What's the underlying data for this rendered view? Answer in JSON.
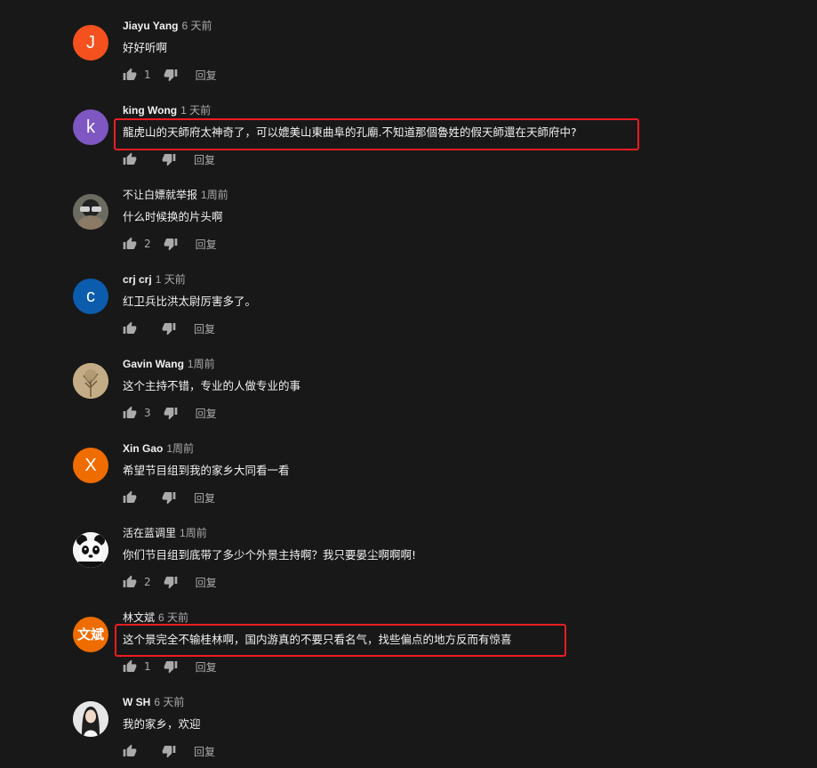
{
  "reply_label": "回复",
  "comments": [
    {
      "author": "Jiayu Yang",
      "time": "6 天前",
      "text": "好好听啊",
      "likes": "1",
      "avatar_letter": "J",
      "avatar_color": "#f4511e",
      "highlighted": false
    },
    {
      "author": "king Wong",
      "time": "1 天前",
      "text": "龍虎山的天師府太神奇了，可以媲美山東曲阜的孔廟.不知道那個魯姓的假天師還在天師府中?",
      "likes": "",
      "avatar_letter": "k",
      "avatar_color": "#7e57c2",
      "highlighted": true
    },
    {
      "author": "不让白嫖就举报",
      "time": "1周前",
      "text": "什么时候换的片头啊",
      "likes": "2",
      "avatar_letter": "",
      "avatar_color": "#5a4a3a",
      "highlighted": false
    },
    {
      "author": "crj crj",
      "time": "1 天前",
      "text": "红卫兵比洪太尉厉害多了。",
      "likes": "",
      "avatar_letter": "c",
      "avatar_color": "#0b5cad",
      "highlighted": false
    },
    {
      "author": "Gavin Wang",
      "time": "1周前",
      "text": "这个主持不错，专业的人做专业的事",
      "likes": "3",
      "avatar_letter": "",
      "avatar_color": "#b9a07a",
      "highlighted": false
    },
    {
      "author": "Xin Gao",
      "time": "1周前",
      "text": "希望节目组到我的家乡大同看一看",
      "likes": "",
      "avatar_letter": "X",
      "avatar_color": "#ef6c00",
      "highlighted": false
    },
    {
      "author": "活在蓝调里",
      "time": "1周前",
      "text": "你们节目组到底带了多少个外景主持啊？我只要晏尘啊啊啊!",
      "likes": "2",
      "avatar_letter": "",
      "avatar_color": "#ffffff",
      "highlighted": false
    },
    {
      "author": "林文斌",
      "time": "6 天前",
      "text": "这个景完全不输桂林啊，国内游真的不要只看名气，找些偏点的地方反而有惊喜",
      "likes": "1",
      "avatar_letter": "文斌",
      "avatar_color": "#ef6c00",
      "highlighted": true
    },
    {
      "author": "W SH",
      "time": "6 天前",
      "text": "我的家乡，欢迎",
      "likes": "",
      "avatar_letter": "",
      "avatar_color": "#d9d9d9",
      "highlighted": false
    }
  ],
  "colors": {
    "background": "#181818",
    "highlight_border": "#ee1d23",
    "text_primary": "#f1f1f1",
    "text_secondary": "#aaaaaa"
  },
  "icons": [
    "thumbs-up-icon",
    "thumbs-down-icon"
  ]
}
